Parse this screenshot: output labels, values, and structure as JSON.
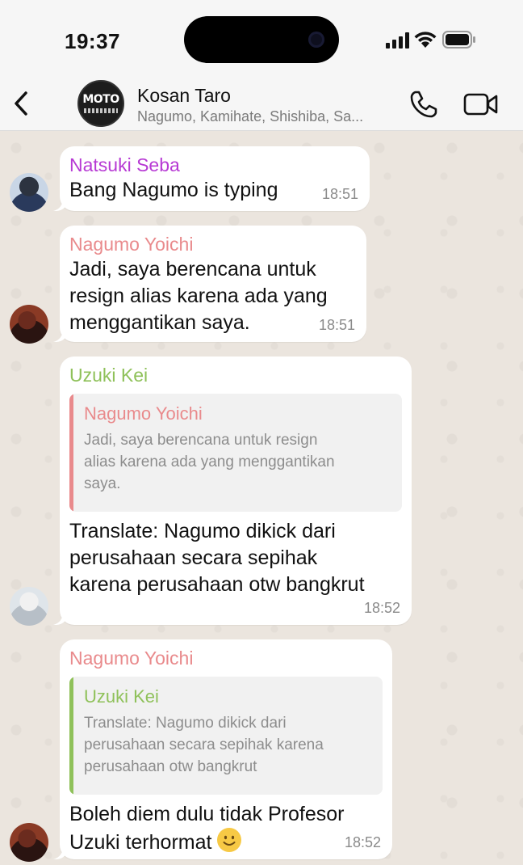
{
  "status_bar": {
    "time": "19:37"
  },
  "header": {
    "group_name": "Kosan Taro",
    "members": "Nagumo, Kamihate, Shishiba, Sa...",
    "avatar_text": "MOTO"
  },
  "colors": {
    "natsuki": "#b73ad4",
    "nagumo": "#e98a8c",
    "uzuki": "#8fc15a"
  },
  "messages": [
    {
      "sender": "Natsuki Seba",
      "text": "Bang Nagumo is typing",
      "time": "18:51"
    },
    {
      "sender": "Nagumo Yoichi",
      "lines": [
        "Jadi, saya berencana untuk",
        "resign alias karena ada yang",
        "menggantikan saya."
      ],
      "time": "18:51"
    },
    {
      "sender": "Uzuki Kei",
      "quote_sender": "Nagumo Yoichi",
      "quote_lines": [
        "Jadi, saya berencana untuk resign",
        "alias karena ada yang menggantikan",
        "saya."
      ],
      "lines": [
        "Translate: Nagumo dikick dari",
        "perusahaan secara sepihak",
        "karena perusahaan otw bangkrut"
      ],
      "time": "18:52"
    },
    {
      "sender": "Nagumo Yoichi",
      "quote_sender": "Uzuki Kei",
      "quote_lines": [
        "Translate: Nagumo dikick dari",
        "perusahaan secara sepihak karena",
        "perusahaan otw bangkrut"
      ],
      "lines": [
        "Boleh diem dulu tidak Profesor",
        "Uzuki terhormat"
      ],
      "time": "18:52"
    }
  ]
}
